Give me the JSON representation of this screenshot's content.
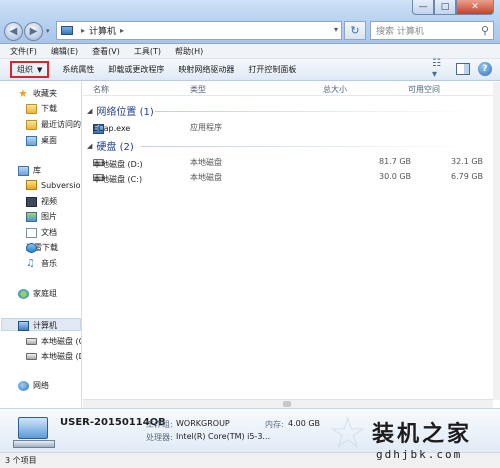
{
  "window": {
    "address_location": "计算机",
    "search_placeholder": "搜索 计算机",
    "controls": {
      "minimize": "—",
      "maximize": "□",
      "close": "✕"
    }
  },
  "menu": [
    "文件(F)",
    "编辑(E)",
    "查看(V)",
    "工具(T)",
    "帮助(H)"
  ],
  "toolbar": {
    "organize": "组织",
    "commands": [
      "系统属性",
      "卸载或更改程序",
      "映射网络驱动器",
      "打开控制面板"
    ],
    "help": "?"
  },
  "sidebar": {
    "favorites": "收藏夹",
    "favorites_items": [
      "下载",
      "最近访问的",
      "桌面"
    ],
    "libraries": "库",
    "library_items": [
      "Subversion",
      "视频",
      "图片",
      "文档",
      "迅雷下载",
      "音乐"
    ],
    "homegroup": "家庭组",
    "computer": "计算机",
    "computer_items": [
      "本地磁盘 (C",
      "本地磁盘 (D"
    ],
    "network": "网络"
  },
  "columns": {
    "name": "名称",
    "type": "类型",
    "total": "总大小",
    "free": "可用空间"
  },
  "groups": [
    {
      "title": "网络位置 (1)",
      "items": [
        {
          "name": "ECap.exe",
          "type": "应用程序",
          "total": "",
          "free": ""
        }
      ]
    },
    {
      "title": "硬盘 (2)",
      "items": [
        {
          "name": "本地磁盘 (D:)",
          "type": "本地磁盘",
          "total": "81.7 GB",
          "free": "32.1 GB"
        },
        {
          "name": "本地磁盘 (C:)",
          "type": "本地磁盘",
          "total": "30.0 GB",
          "free": "6.79 GB"
        }
      ]
    }
  ],
  "details": {
    "computer_name": "USER-20150114QB",
    "workgroup_label": "工作组:",
    "workgroup": "WORKGROUP",
    "memory_label": "内存:",
    "memory": "4.00 GB",
    "processor_label": "处理器:",
    "processor": "Intel(R) Core(TM) i5-3..."
  },
  "status": "3 个项目",
  "watermark": {
    "title": "装机之家",
    "url": "gdhjbk.com"
  }
}
